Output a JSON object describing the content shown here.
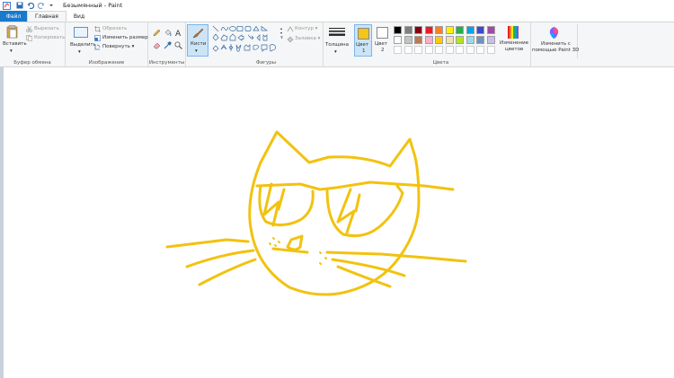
{
  "window": {
    "title": "Безымянный - Paint"
  },
  "tabs": {
    "file": "Файл",
    "home": "Главная",
    "view": "Вид"
  },
  "clipboard": {
    "paste": "Вставить",
    "cut": "Вырезать",
    "copy": "Копировать",
    "title": "Буфер обмена"
  },
  "image": {
    "select": "Выделить",
    "crop": "Обрезать",
    "resize": "Изменить размер",
    "rotate": "Повернуть",
    "title": "Изображение"
  },
  "tools": {
    "title": "Инструменты"
  },
  "brushes": {
    "label": "Кисти"
  },
  "shapes": {
    "outline": "Контур",
    "fill": "Заливка",
    "title": "Фигуры"
  },
  "size": {
    "label": "Толщина"
  },
  "colors": {
    "color1": "Цвет",
    "color1_num": "1",
    "color2": "Цвет",
    "color2_num": "2",
    "edit1": "Изменение",
    "edit2": "цветов",
    "title": "Цвета",
    "color1_value": "#f5c518",
    "color2_value": "#ffffff",
    "palette_row1": [
      "#000000",
      "#7f7f7f",
      "#880015",
      "#ed1c24",
      "#ff7f27",
      "#fff200",
      "#22b14c",
      "#00a2e8",
      "#3f48cc",
      "#a349a4"
    ],
    "palette_row2": [
      "#ffffff",
      "#c3c3c3",
      "#b97a57",
      "#ffaec9",
      "#ffc90e",
      "#efe4b0",
      "#b5e61d",
      "#99d9ea",
      "#7092be",
      "#c8bfe7"
    ],
    "palette_row3": [
      "#ffffff",
      "#ffffff",
      "#ffffff",
      "#ffffff",
      "#ffffff",
      "#ffffff",
      "#ffffff",
      "#ffffff",
      "#ffffff",
      "#ffffff"
    ]
  },
  "paint3d": {
    "line1": "Изменить с",
    "line2": "помощью Paint 3D"
  },
  "drawing": {
    "stroke_color": "#f2c20f",
    "subject": "cat-with-sunglasses"
  }
}
